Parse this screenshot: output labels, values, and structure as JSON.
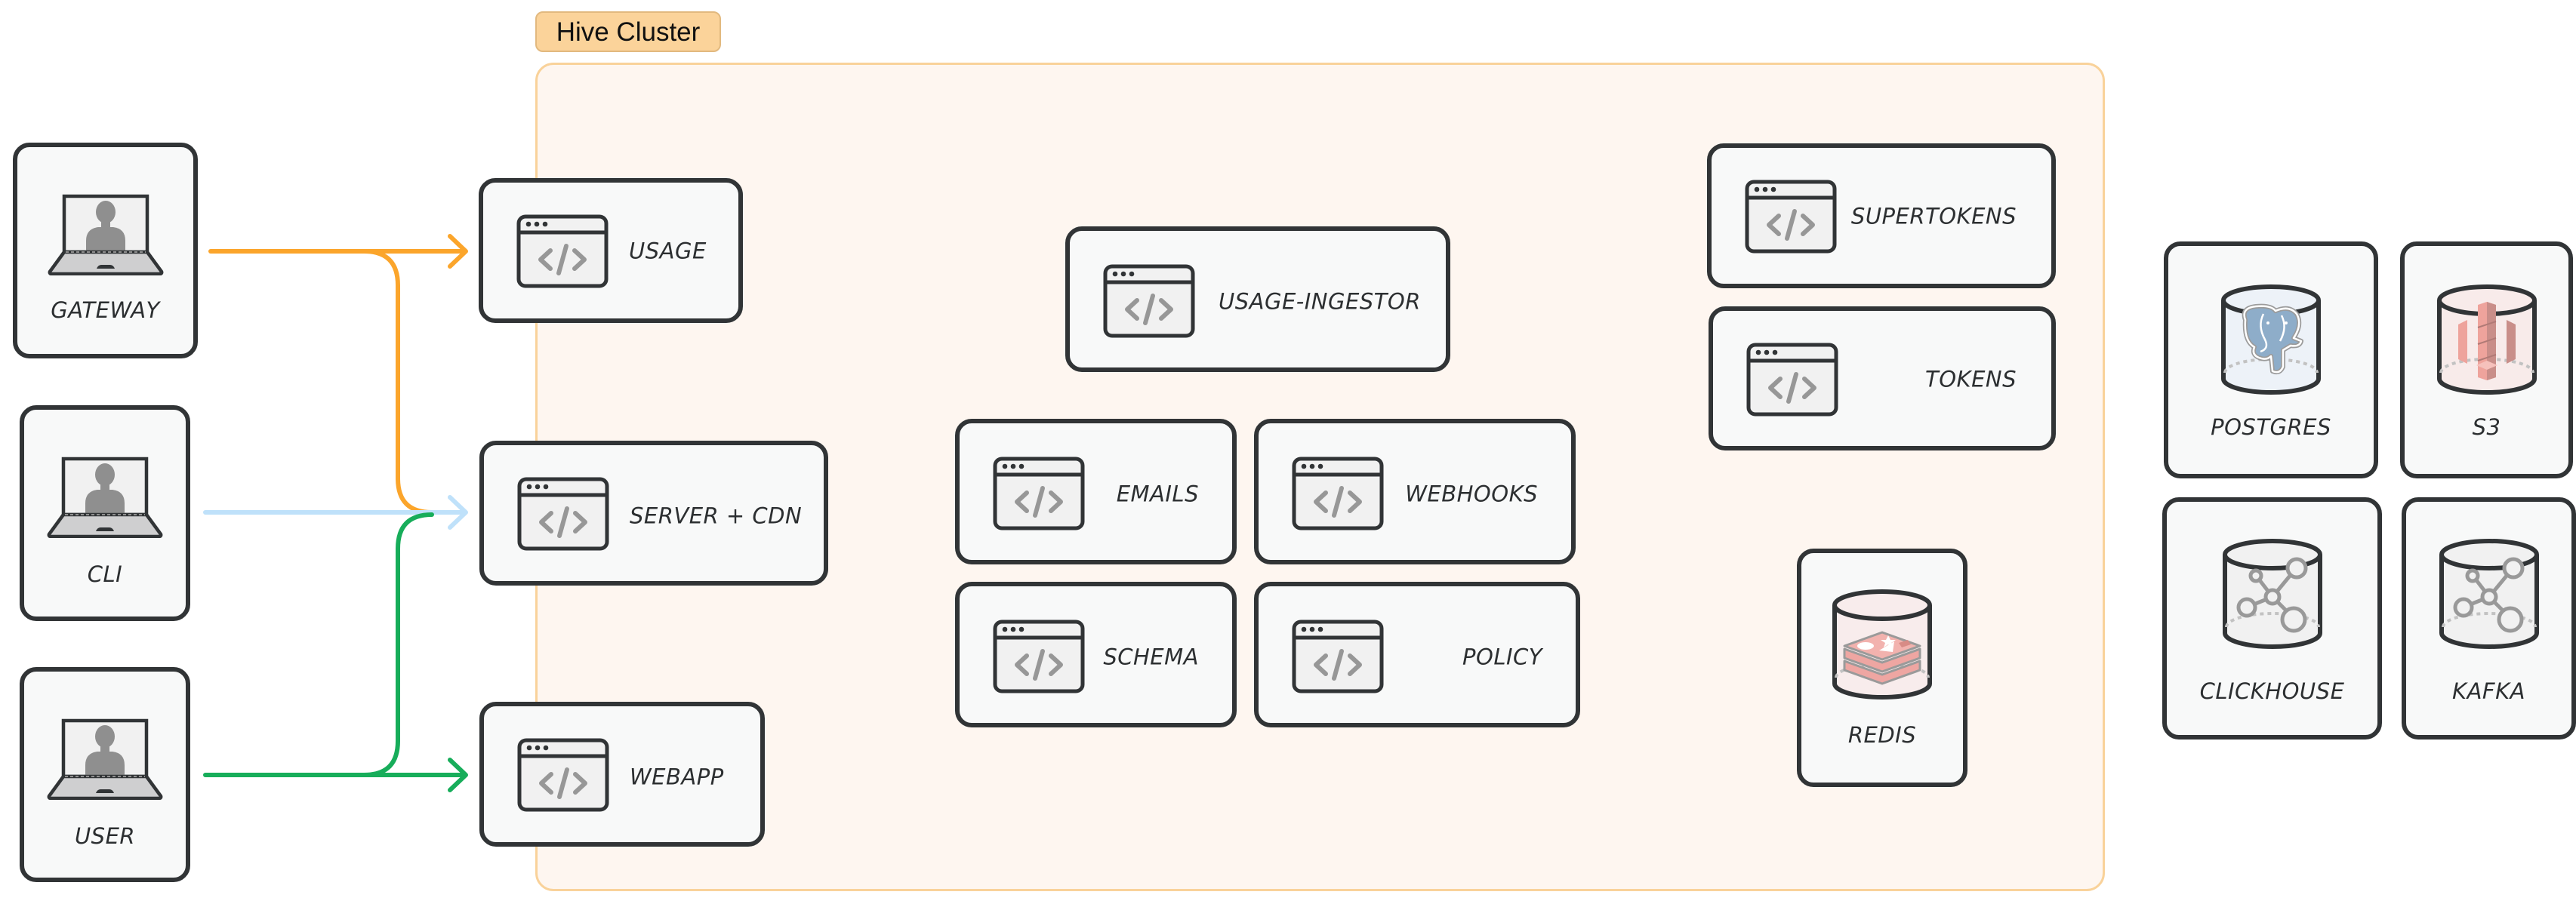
{
  "cluster": {
    "label": "Hive Cluster",
    "fill": "#fef6f0",
    "border": "#f9d29a",
    "label_fill": "#fbd39a"
  },
  "clients": [
    {
      "id": "gateway",
      "label": "GATEWAY",
      "icon": "laptop-user-icon"
    },
    {
      "id": "cli",
      "label": "CLI",
      "icon": "laptop-user-icon"
    },
    {
      "id": "user",
      "label": "USER",
      "icon": "laptop-user-icon"
    }
  ],
  "services": [
    {
      "id": "usage",
      "label": "USAGE",
      "icon": "browser-code-icon"
    },
    {
      "id": "server-cdn",
      "label": "SERVER + CDN",
      "icon": "browser-code-icon"
    },
    {
      "id": "webapp",
      "label": "WEBAPP",
      "icon": "browser-code-icon"
    },
    {
      "id": "usage-ingestor",
      "label": "USAGE-INGESTOR",
      "icon": "browser-code-icon"
    },
    {
      "id": "emails",
      "label": "EMAILS",
      "icon": "browser-code-icon"
    },
    {
      "id": "webhooks",
      "label": "WEBHOOKS",
      "icon": "browser-code-icon"
    },
    {
      "id": "schema",
      "label": "SCHEMA",
      "icon": "browser-code-icon"
    },
    {
      "id": "policy",
      "label": "POLICY",
      "icon": "browser-code-icon"
    },
    {
      "id": "supertokens",
      "label": "SUPERTOKENS",
      "icon": "browser-code-icon"
    },
    {
      "id": "tokens",
      "label": "TOKENS",
      "icon": "browser-code-icon"
    }
  ],
  "datastores": [
    {
      "id": "redis",
      "label": "REDIS",
      "icon": "redis-database-icon",
      "tint": "#f8ecec"
    },
    {
      "id": "postgres",
      "label": "POSTGRES",
      "icon": "postgres-database-icon",
      "tint": "#edf2f8"
    },
    {
      "id": "s3",
      "label": "S3",
      "icon": "s3-bucket-icon",
      "tint": "#f8ebea"
    },
    {
      "id": "clickhouse",
      "label": "CLICKHOUSE",
      "icon": "network-database-icon",
      "tint": "#f1f1f1"
    },
    {
      "id": "kafka",
      "label": "KAFKA",
      "icon": "network-database-icon",
      "tint": "#f1f1f1"
    }
  ],
  "connections": [
    {
      "from": "GATEWAY",
      "to": "USAGE",
      "color": "#fba52b"
    },
    {
      "from": "GATEWAY",
      "to": "SERVER + CDN",
      "color": "#fba52b"
    },
    {
      "from": "CLI",
      "to": "SERVER + CDN",
      "color": "#bfe1fa"
    },
    {
      "from": "USER",
      "to": "WEBAPP",
      "color": "#17ad5a"
    },
    {
      "from": "USER",
      "to": "SERVER + CDN",
      "color": "#17ad5a"
    }
  ]
}
